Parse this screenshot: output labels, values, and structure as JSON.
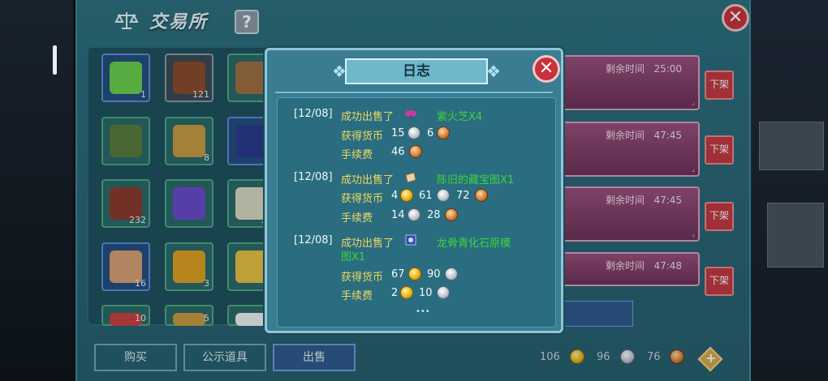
{
  "header": {
    "title": "交易所",
    "help_label": "?",
    "close_label": "✕"
  },
  "inventory": {
    "counts": [
      "1",
      "121",
      "2",
      "",
      "8",
      "2",
      "232",
      "",
      "15",
      "16",
      "3",
      "",
      "10",
      "5",
      "",
      "",
      "",
      ""
    ]
  },
  "listings": [
    {
      "time_label": "剩余时间",
      "time": "25:00",
      "action": "下架"
    },
    {
      "time_label": "剩余时间",
      "time": "47:45",
      "action": "下架"
    },
    {
      "time_label": "剩余时间",
      "time": "47:45",
      "action": "下架"
    },
    {
      "time_label": "剩余时间",
      "time": "47:48",
      "action": "下架"
    }
  ],
  "tabs": {
    "buy": "购买",
    "public": "公示道具",
    "sell": "出售"
  },
  "currency": {
    "gold": "106",
    "silver": "96",
    "bronze": "76"
  },
  "log": {
    "title": "日志",
    "close_label": "✕",
    "entries": [
      {
        "date": "[12/08]",
        "action": "成功出售了",
        "item": "紫火芝X4",
        "earn_label": "获得货币",
        "earn_silver": "15",
        "earn_bronze": "6",
        "fee_label": "手续费",
        "fee_bronze": "46"
      },
      {
        "date": "[12/08]",
        "action": "成功出售了",
        "item": "陈旧的藏宝图X1",
        "earn_label": "获得货币",
        "earn_gold": "4",
        "earn_silver": "61",
        "earn_bronze": "72",
        "fee_label": "手续费",
        "fee_silver": "14",
        "fee_bronze": "28"
      },
      {
        "date": "[12/08]",
        "action": "成功出售了",
        "item": "龙骨青化石原模",
        "item_cont": "图X1",
        "earn_label": "获得货币",
        "earn_gold": "67",
        "earn_silver": "90",
        "fee_label": "手续费",
        "fee_gold": "2",
        "fee_silver": "10"
      }
    ],
    "more": "•••"
  },
  "colors": {
    "panel": "#2e6f7c",
    "modal": "#3a7d93",
    "listing": "#9a4f7a",
    "close": "#c8323a",
    "item_name": "#3ed43a",
    "label": "#f0d860"
  }
}
